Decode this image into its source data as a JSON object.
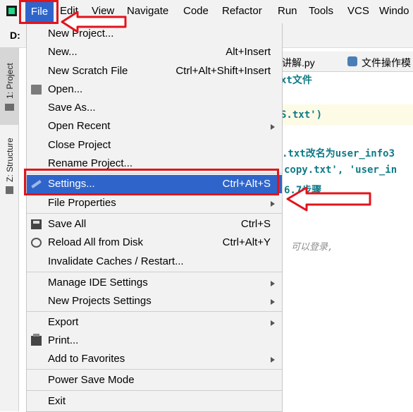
{
  "menubar": {
    "items": [
      "File",
      "Edit",
      "View",
      "Navigate",
      "Code",
      "Refactor",
      "Run",
      "Tools",
      "VCS",
      "Windo"
    ]
  },
  "project_label": "D:",
  "sidebar": {
    "project_tab": "1: Project",
    "structure_tab": "Z: Structure"
  },
  "tabs": [
    {
      "label": "讲解.py"
    },
    {
      "label": "文件操作模"
    }
  ],
  "code_lines": [
    "xt文件",
    "S.txt')",
    ".txt改名为user_info3",
    "copy.txt', 'user_in",
    "6.7步骤"
  ],
  "code_comment": "可以登录,",
  "file_menu": {
    "items": [
      {
        "label": "New Project...",
        "shortcut": "",
        "submenu": false,
        "icon": ""
      },
      {
        "label": "New...",
        "shortcut": "Alt+Insert",
        "submenu": false,
        "icon": ""
      },
      {
        "label": "New Scratch File",
        "shortcut": "Ctrl+Alt+Shift+Insert",
        "submenu": false,
        "icon": ""
      },
      {
        "label": "Open...",
        "shortcut": "",
        "submenu": false,
        "icon": "folder-icon"
      },
      {
        "label": "Save As...",
        "shortcut": "",
        "submenu": false,
        "icon": ""
      },
      {
        "label": "Open Recent",
        "shortcut": "",
        "submenu": true,
        "icon": ""
      },
      {
        "label": "Close Project",
        "shortcut": "",
        "submenu": false,
        "icon": ""
      },
      {
        "label": "Rename Project...",
        "shortcut": "",
        "submenu": false,
        "icon": ""
      },
      {
        "label": "Settings...",
        "shortcut": "Ctrl+Alt+S",
        "submenu": false,
        "icon": "wrench-icon",
        "selected": true
      },
      {
        "label": "File Properties",
        "shortcut": "",
        "submenu": true,
        "icon": ""
      },
      {
        "label": "Save All",
        "shortcut": "Ctrl+S",
        "submenu": false,
        "icon": "save-icon"
      },
      {
        "label": "Reload All from Disk",
        "shortcut": "Ctrl+Alt+Y",
        "submenu": false,
        "icon": "reload-icon"
      },
      {
        "label": "Invalidate Caches / Restart...",
        "shortcut": "",
        "submenu": false,
        "icon": ""
      },
      {
        "label": "Manage IDE Settings",
        "shortcut": "",
        "submenu": true,
        "icon": ""
      },
      {
        "label": "New Projects Settings",
        "shortcut": "",
        "submenu": true,
        "icon": ""
      },
      {
        "label": "Export",
        "shortcut": "",
        "submenu": true,
        "icon": ""
      },
      {
        "label": "Print...",
        "shortcut": "",
        "submenu": false,
        "icon": "print-icon"
      },
      {
        "label": "Add to Favorites",
        "shortcut": "",
        "submenu": true,
        "icon": ""
      },
      {
        "label": "Power Save Mode",
        "shortcut": "",
        "submenu": false,
        "icon": ""
      },
      {
        "label": "Exit",
        "shortcut": "",
        "submenu": false,
        "icon": ""
      }
    ]
  },
  "colors": {
    "selection_blue": "#2f65ca",
    "annotation_red": "#e1141c",
    "code_teal": "#0f7b88"
  }
}
